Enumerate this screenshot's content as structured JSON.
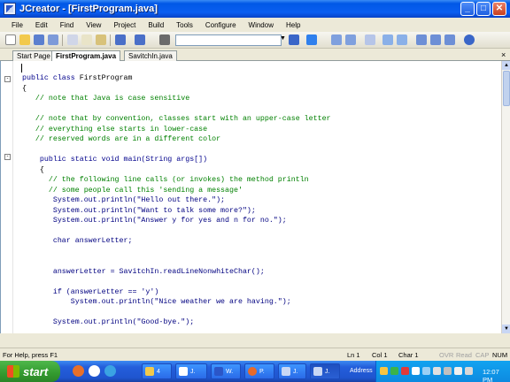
{
  "window": {
    "title": "JCreator - [FirstProgram.java]",
    "minimize_label": "_",
    "maximize_label": "□",
    "close_label": "✕"
  },
  "menu": [
    "File",
    "Edit",
    "Find",
    "View",
    "Project",
    "Build",
    "Tools",
    "Configure",
    "Window",
    "Help"
  ],
  "tabs": {
    "start": "Start Page",
    "active": "FirstProgram.java",
    "other": "SavitchIn.java",
    "close": "×"
  },
  "code": [
    "public class FirstProgram",
    "{",
    "   // note that Java is case sensitive",
    "",
    "   // note that by convention, classes start with an upper-case letter",
    "   // everything else starts in lower-case",
    "   // reserved words are in a different color",
    "",
    "    public static void main(String args[])",
    "    {",
    "      // the following line calls (or invokes) the method println",
    "      // some people call this 'sending a message'",
    "       System.out.println(\"Hello out there.\");",
    "       System.out.println(\"Want to talk some more?\");",
    "       System.out.println(\"Answer y for yes and n for no.\");",
    "",
    "       char answerLetter;",
    "",
    "",
    "       answerLetter = SavitchIn.readLineNonwhiteChar();",
    "",
    "       if (answerLetter == 'y')",
    "           System.out.println(\"Nice weather we are having.\");",
    "",
    "       System.out.println(\"Good-bye.\");"
  ],
  "status": {
    "help": "For Help, press F1",
    "ln": "Ln 1",
    "col": "Col 1",
    "char": "Char 1",
    "ovr": "OVR",
    "read": "Read",
    "cap": "CAP",
    "num": "NUM"
  },
  "taskbar": {
    "start": "start",
    "tasks": [
      {
        "label": "4",
        "icon_color": "#f2c94c"
      },
      {
        "label": "J.",
        "icon_color": "#ffffff"
      },
      {
        "label": "W.",
        "icon_color": "#2b56c8"
      },
      {
        "label": "P.",
        "icon_color": "#e86a2a"
      },
      {
        "label": "J.",
        "icon_color": "#c9d7f5"
      },
      {
        "label": "J.",
        "icon_color": "#c9d7f5"
      }
    ],
    "address": "Address",
    "clock": "12:07 PM"
  }
}
